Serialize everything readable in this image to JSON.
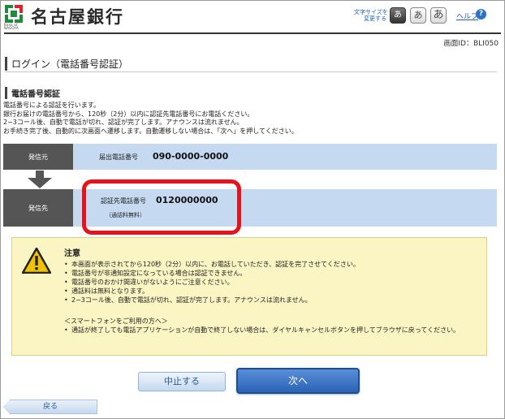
{
  "header": {
    "bank_name": "名古屋銀行",
    "logo_small": "Bank of\nNAGOYA",
    "font_size_label": "文字サイズを\n変更する",
    "font_sizes": [
      "あ",
      "あ",
      "あ"
    ],
    "help_label": "ヘルプ",
    "help_icon": "?",
    "screen_id": "画面ID：BLI050"
  },
  "page": {
    "title": "ログイン（電話番号認証）",
    "section_title": "電話番号認証",
    "description": [
      "電話番号による認証を行います。",
      "銀行お届けの電話番号から、120秒（2分）以内に認証先電話番号にお電話ください。",
      "2~3コール後、自動で電話が切れ、認証が完了します。アナウンスは流れません。",
      "お手続き完了後、自動的に次画面へ遷移します。自動遷移しない場合は、「次へ」を押してください。"
    ]
  },
  "caller": {
    "label": "発信元",
    "field_label": "届出電話番号",
    "number": "090-0000-0000"
  },
  "callee": {
    "label": "発信先",
    "field_label": "認証先電話番号",
    "number": "0120000000",
    "toll_note": "（通話料無料）"
  },
  "notice": {
    "title": "注意",
    "items": [
      "本画面が表示されてから120秒（2分）以内に、お電話していただき、認証を完了させてください。",
      "電話番号が非通知設定になっている場合は認証できません。",
      "電話番号のおかけ間違いがないようにご注意ください。",
      "通話料は無料となります。",
      "2~3コール後、自動で電話が切れ、認証が完了します。アナウンスは流れません。"
    ],
    "smartphone_heading": "＜スマートフォンをご利用の方へ＞",
    "smartphone_items": [
      "通話が終了しても電話アプリケーションが自動で終了しない場合は、ダイヤルキャンセルボタンを押してブラウザに戻ってください。"
    ]
  },
  "buttons": {
    "cancel": "中止する",
    "next": "次へ",
    "back": "戻る"
  },
  "colors": {
    "brand_green": "#1f8a3c",
    "brand_red": "#d9232d",
    "row_blue": "#c5daf1",
    "highlight_red": "#e8131a",
    "notice_yellow": "#fbf5c3"
  }
}
